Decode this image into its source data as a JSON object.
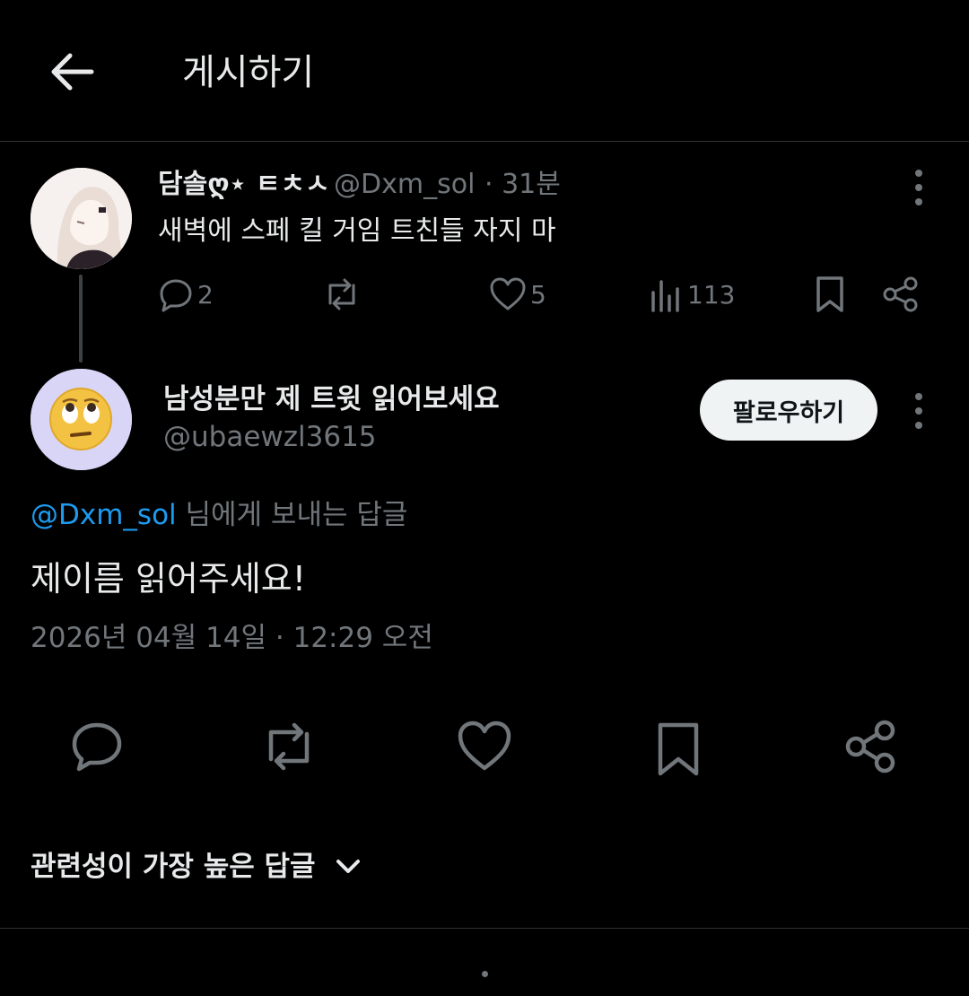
{
  "header": {
    "title": "게시하기",
    "back_icon": "arrow-left-icon"
  },
  "parent_tweet": {
    "display_name": "담솔ღ⋆ ㅌㅊㅅ",
    "handle": "@Dxm_sol",
    "time": "· 31분",
    "text": "새벽에 스페 킬 거임 트친들 자지 마",
    "actions": {
      "replies": "2",
      "likes": "5",
      "views": "113"
    }
  },
  "reply_tweet": {
    "display_name": "남성분만 제 트윗 읽어보세요",
    "handle": "@ubaewzl3615",
    "follow_label": "팔로우하기",
    "replying_to_handle": "@Dxm_sol",
    "replying_to_suffix": " 님에게 보내는 답글",
    "text": "제이름 읽어주세요!",
    "timestamp": "2026년 04월 14일 · 12:29 오전"
  },
  "sort": {
    "label": "관련성이 가장 높은 답글",
    "icon": "chevron-down-icon"
  },
  "colors": {
    "background": "#000000",
    "text": "#e7e9ea",
    "muted": "#71767b",
    "accent": "#1d9bf0",
    "divider": "#2f3336"
  }
}
